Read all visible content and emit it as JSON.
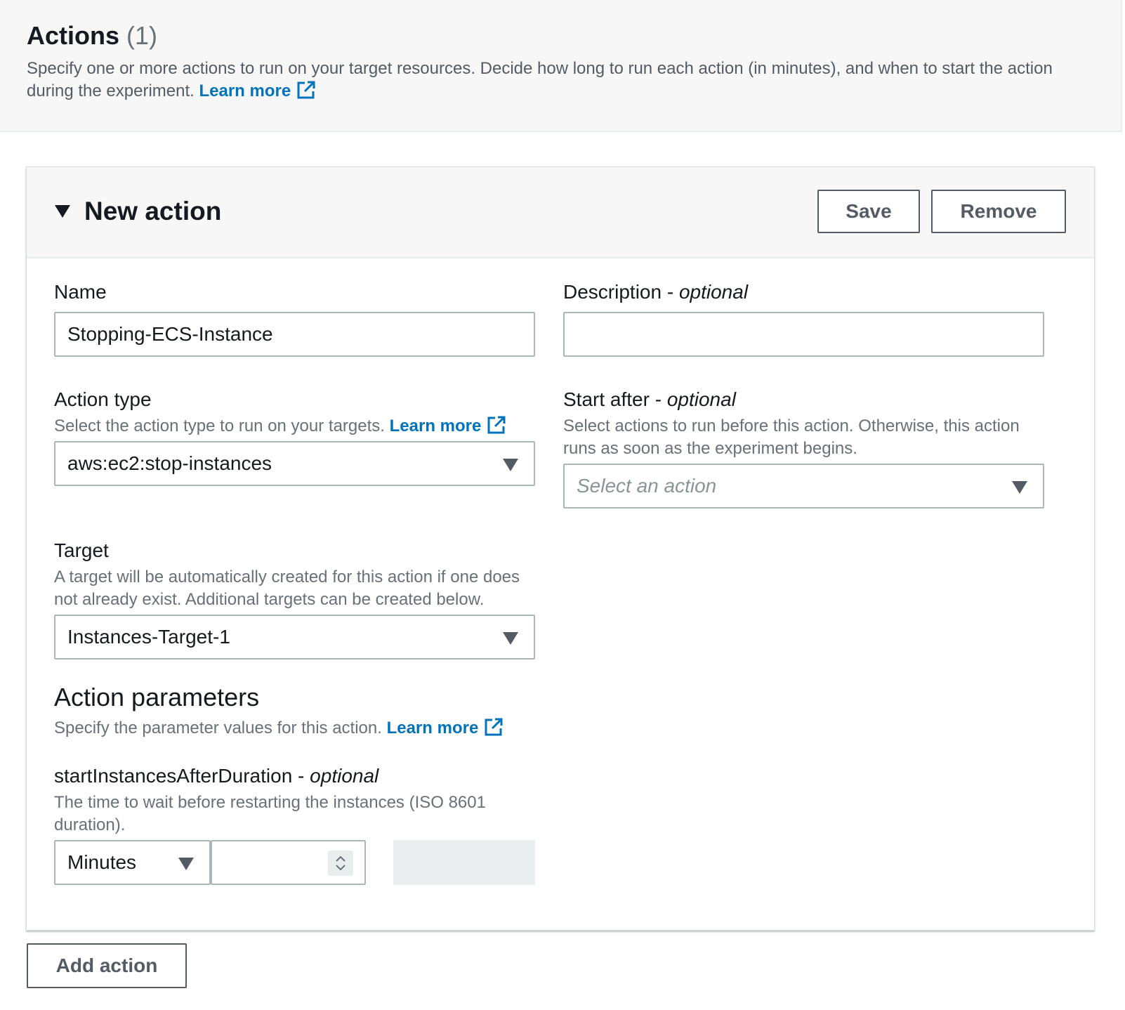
{
  "header": {
    "title": "Actions",
    "count": "(1)",
    "description": "Specify one or more actions to run on your target resources. Decide how long to run each action (in minutes), and when to start the action during the experiment.",
    "learn_more": "Learn more"
  },
  "action_card": {
    "title": "New action",
    "save_label": "Save",
    "remove_label": "Remove",
    "name": {
      "label": "Name",
      "value": "Stopping-ECS-Instance"
    },
    "description": {
      "label": "Description",
      "optional_sep": " - ",
      "optional": "optional",
      "value": ""
    },
    "action_type": {
      "label": "Action type",
      "hint": "Select the action type to run on your targets.",
      "learn_more": "Learn more",
      "value": "aws:ec2:stop-instances"
    },
    "start_after": {
      "label": "Start after",
      "optional_sep": " - ",
      "optional": "optional",
      "hint": "Select actions to run before this action. Otherwise, this action runs as soon as the experiment begins.",
      "placeholder": "Select an action"
    },
    "target": {
      "label": "Target",
      "hint": "A target will be automatically created for this action if one does not already exist. Additional targets can be created below.",
      "value": "Instances-Target-1"
    },
    "action_parameters": {
      "title": "Action parameters",
      "hint": "Specify the parameter values for this action.",
      "learn_more": "Learn more"
    },
    "start_instances_after_duration": {
      "label": "startInstancesAfterDuration",
      "optional_sep": " - ",
      "optional": "optional",
      "hint": "The time to wait before restarting the instances (ISO 8601 duration).",
      "unit_value": "Minutes",
      "number_value": ""
    }
  },
  "add_action_label": "Add action",
  "colors": {
    "link": "#0073bb",
    "text": "#16191f",
    "secondary_text": "#687078",
    "button_border": "#545b64",
    "input_border": "#aab7b8",
    "header_bg": "#f7f7f7"
  },
  "icons": {
    "external_link": "external-link-icon",
    "expand_caret": "caret-down-icon",
    "select_caret": "caret-down-icon",
    "stepper": "spinner-arrows-icon"
  }
}
